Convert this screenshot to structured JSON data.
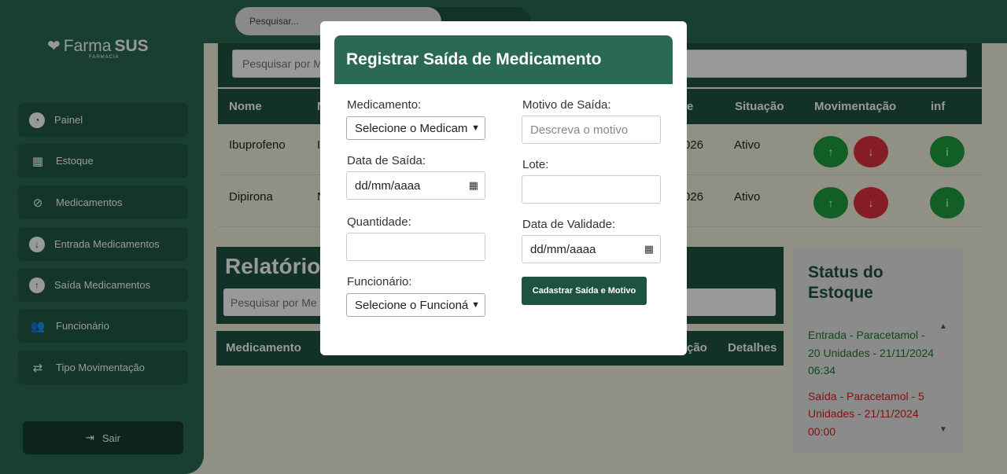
{
  "brand": {
    "name_a": "Farma",
    "name_b": "SUS",
    "subtitle": "FARMACIA"
  },
  "topbar": {
    "search_placeholder": "Pesquisar..."
  },
  "sidebar": {
    "items": [
      {
        "label": "Painel",
        "icon": "dashboard-icon"
      },
      {
        "label": "Estoque",
        "icon": "boxes-icon"
      },
      {
        "label": "Medicamentos",
        "icon": "pills-icon"
      },
      {
        "label": "Entrada Medicamentos",
        "icon": "arrow-down-circle-icon"
      },
      {
        "label": "Saída Medicamentos",
        "icon": "arrow-up-circle-icon"
      },
      {
        "label": "Funcionário",
        "icon": "users-icon"
      },
      {
        "label": "Tipo Movimentação",
        "icon": "exchange-icon"
      }
    ],
    "logout_label": "Sair"
  },
  "stock_table": {
    "search_placeholder": "Pesquisar por M",
    "headers": {
      "name": "Nome",
      "col2": "N",
      "col_e": "e",
      "status": "Situação",
      "movement": "Movimentação",
      "info": "inf"
    },
    "rows": [
      {
        "name": "Ibuprofeno",
        "col2": "I",
        "date_frag": "026",
        "status": "Ativo"
      },
      {
        "name": "Dipirona",
        "col2": "N",
        "date_frag": "026",
        "status": "Ativo"
      }
    ],
    "up_glyph": "↑",
    "down_glyph": "↓",
    "info_glyph": "i"
  },
  "report": {
    "title": "Relatório",
    "search_placeholder": "Pesquisar por Me",
    "headers": {
      "medication": "Medicamento",
      "action_frag": "ção",
      "details": "Detalhes"
    }
  },
  "status": {
    "title": "Status do Estoque",
    "entries": [
      {
        "text": "Entrada - Paracetamol - 20 Unidades - 21/11/2024 06:34",
        "type": "in"
      },
      {
        "text": "Saída - Paracetamol - 5 Unidades - 21/11/2024 00:00",
        "type": "out"
      }
    ],
    "colors": {
      "in": "#1e7a2e",
      "out": "#d42020"
    }
  },
  "modal": {
    "title": "Registrar Saída de Medicamento",
    "medication_label": "Medicamento:",
    "medication_value": "Selecione o Medicam",
    "exit_date_label": "Data de Saída:",
    "exit_date_value": "dd/mm/aaaa",
    "quantity_label": "Quantidade:",
    "employee_label": "Funcionário:",
    "employee_value": "Selecione o Funcioná",
    "reason_label": "Motivo de Saída:",
    "reason_placeholder": "Descreva o motivo",
    "batch_label": "Lote:",
    "expiry_label": "Data de Validade:",
    "expiry_value": "dd/mm/aaaa",
    "submit_label": "Cadastrar Saída e Motivo"
  },
  "colors": {
    "primary": "#2b6a52",
    "primary_dark": "#1f5341",
    "background": "#f1f1dd"
  }
}
